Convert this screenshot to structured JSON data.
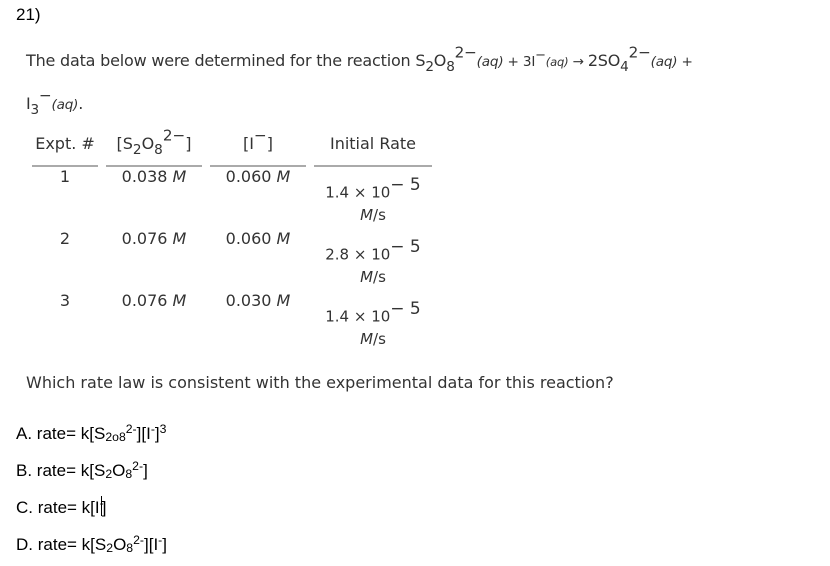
{
  "question_number": "21)",
  "prompt": {
    "lead": "The data below were determined for the reaction ",
    "reactant1": {
      "base": "S",
      "sub1": "2",
      "mid": "O",
      "sub2": "8",
      "charge": "2−",
      "state": "(aq)"
    },
    "plus1": " + 3I",
    "reactant2_charge": "−",
    "reactant2_state": "(aq)",
    "arrow": " → ",
    "product1": {
      "coef": "2SO",
      "sub": "4",
      "charge": "2−",
      "state": "(aq)"
    },
    "plus2": " +",
    "product2": {
      "base": "I",
      "sub": "3",
      "charge": "−",
      "state": "(aq)",
      "tail": "."
    }
  },
  "table": {
    "headers": {
      "expt": "Expt. #",
      "s2o8": {
        "open": "[S",
        "sub1": "2",
        "mid": "O",
        "sub2": "8",
        "charge": "2−",
        "close": "]"
      },
      "iodide": {
        "open": "[I",
        "charge": "−",
        "close": "]"
      },
      "rate": "Initial Rate"
    },
    "rows": [
      {
        "expt": "1",
        "s2o8": "0.038",
        "iodide": "0.060",
        "conc_unit": "M",
        "rate_mantissa": "1.4 × 10",
        "rate_exp": "− 5",
        "rate_unit_m": "M",
        "rate_unit_rest": "/s"
      },
      {
        "expt": "2",
        "s2o8": "0.076",
        "iodide": "0.060",
        "conc_unit": "M",
        "rate_mantissa": "2.8 × 10",
        "rate_exp": "− 5",
        "rate_unit_m": "M",
        "rate_unit_rest": "/s"
      },
      {
        "expt": "3",
        "s2o8": "0.076",
        "iodide": "0.030",
        "conc_unit": "M",
        "rate_mantissa": "1.4 × 10",
        "rate_exp": "− 5",
        "rate_unit_m": "M",
        "rate_unit_rest": "/s"
      }
    ]
  },
  "question": "Which rate law is consistent with the experimental data for this reaction?",
  "options": [
    {
      "letter": "A.",
      "text": "rate= k[S",
      "s_sub1": "2",
      "mid": "o",
      "s_sub2": "8",
      "charge": "2-",
      "after": "][I",
      "i_charge": "-",
      "close": "]",
      "power": "3"
    },
    {
      "letter": "B.",
      "text": "rate= k[S",
      "s_sub1": "2",
      "mid": "O",
      "s_sub2": "8",
      "charge": "2-",
      "close": "]"
    },
    {
      "letter": "C.",
      "text": "rate= k[I",
      "i_charge": "-",
      "close": "]"
    },
    {
      "letter": "D.",
      "text": "rate= k[S",
      "s_sub1": "2",
      "mid": "O",
      "s_sub2": "8",
      "charge": "2-",
      "after": "][I",
      "i_charge": "-",
      "close": "]"
    }
  ]
}
